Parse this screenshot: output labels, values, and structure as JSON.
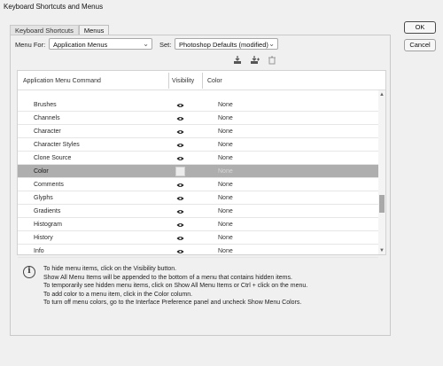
{
  "window": {
    "title": "Keyboard Shortcuts and Menus"
  },
  "tabs": [
    {
      "label": "Keyboard Shortcuts",
      "active": false
    },
    {
      "label": "Menus",
      "active": true
    }
  ],
  "menu_for": {
    "label": "Menu For:",
    "value": "Application Menus"
  },
  "set": {
    "label": "Set:",
    "value": "Photoshop Defaults (modified)"
  },
  "toolbar_icons": [
    "save-set-icon",
    "save-set-as-icon",
    "delete-set-icon"
  ],
  "table": {
    "headers": {
      "command": "Application Menu Command",
      "visibility": "Visibility",
      "color": "Color"
    },
    "rows": [
      {
        "command": "Brushes",
        "color": "None",
        "selected": false
      },
      {
        "command": "Channels",
        "color": "None",
        "selected": false
      },
      {
        "command": "Character",
        "color": "None",
        "selected": false
      },
      {
        "command": "Character Styles",
        "color": "None",
        "selected": false
      },
      {
        "command": "Clone Source",
        "color": "None",
        "selected": false
      },
      {
        "command": "Color",
        "color": "None",
        "selected": true
      },
      {
        "command": "Comments",
        "color": "None",
        "selected": false
      },
      {
        "command": "Glyphs",
        "color": "None",
        "selected": false
      },
      {
        "command": "Gradients",
        "color": "None",
        "selected": false
      },
      {
        "command": "Histogram",
        "color": "None",
        "selected": false
      },
      {
        "command": "History",
        "color": "None",
        "selected": false
      },
      {
        "command": "Info",
        "color": "None",
        "selected": false
      }
    ]
  },
  "help_lines": [
    "To hide menu items, click on the Visibility button.",
    "Show All Menu Items will be appended to the bottom of a menu that contains hidden items.",
    "To temporarily see hidden menu items, click on Show All Menu Items or Ctrl + click on the menu.",
    "To add color to a menu item, click in the Color column.",
    "To turn off menu colors, go to the Interface Preference panel and uncheck Show Menu Colors."
  ],
  "buttons": {
    "ok": "OK",
    "cancel": "Cancel"
  },
  "colors": {
    "selected_row": "#aeaeae",
    "background": "#f0f0f0"
  }
}
